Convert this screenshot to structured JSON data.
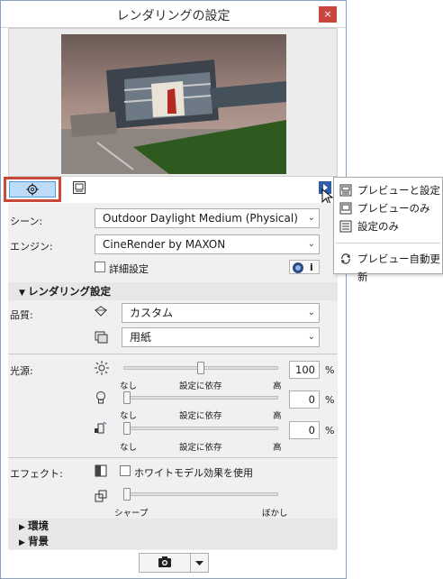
{
  "window": {
    "title": "レンダリングの設定",
    "close_glyph": "×"
  },
  "scene": {
    "label": "シーン:",
    "value": "Outdoor Daylight Medium (Physical)"
  },
  "engine": {
    "label": "エンジン:",
    "value": "CineRender by MAXON",
    "advanced_label": "詳細設定",
    "info_glyph": "i"
  },
  "render_settings": {
    "header": "レンダリング設定",
    "quality_label": "品質:",
    "quality_value": "カスタム",
    "paper_value": "用紙"
  },
  "light": {
    "label": "光源:",
    "sliders": [
      {
        "value": "100",
        "value_fraction": 0.5,
        "unit": "%",
        "min_label": "なし",
        "mid_label": "設定に依存",
        "max_label": "高"
      },
      {
        "value": "0",
        "value_fraction": 0.0,
        "unit": "%",
        "min_label": "なし",
        "mid_label": "設定に依存",
        "max_label": "高"
      },
      {
        "value": "0",
        "value_fraction": 0.0,
        "unit": "%",
        "min_label": "なし",
        "mid_label": "設定に依存",
        "max_label": "高"
      }
    ]
  },
  "effects": {
    "label": "エフェクト:",
    "white_model_label": "ホワイトモデル効果を使用",
    "sharp_label": "シャープ",
    "blur_label": "ぼかし",
    "blur_fraction": 0.0
  },
  "sections": {
    "environment": "環境",
    "background": "背景"
  },
  "popup": {
    "items": [
      {
        "label": "プレビューと設定",
        "icon": "preview-and-settings-icon"
      },
      {
        "label": "プレビューのみ",
        "icon": "preview-only-icon"
      },
      {
        "label": "設定のみ",
        "icon": "settings-only-icon"
      },
      {
        "label": "プレビュー自動更新",
        "icon": "auto-refresh-icon"
      }
    ]
  },
  "colors": {
    "accent_blue": "#4d9be0",
    "highlight_red": "#c8493a",
    "close_red": "#c9463d"
  }
}
